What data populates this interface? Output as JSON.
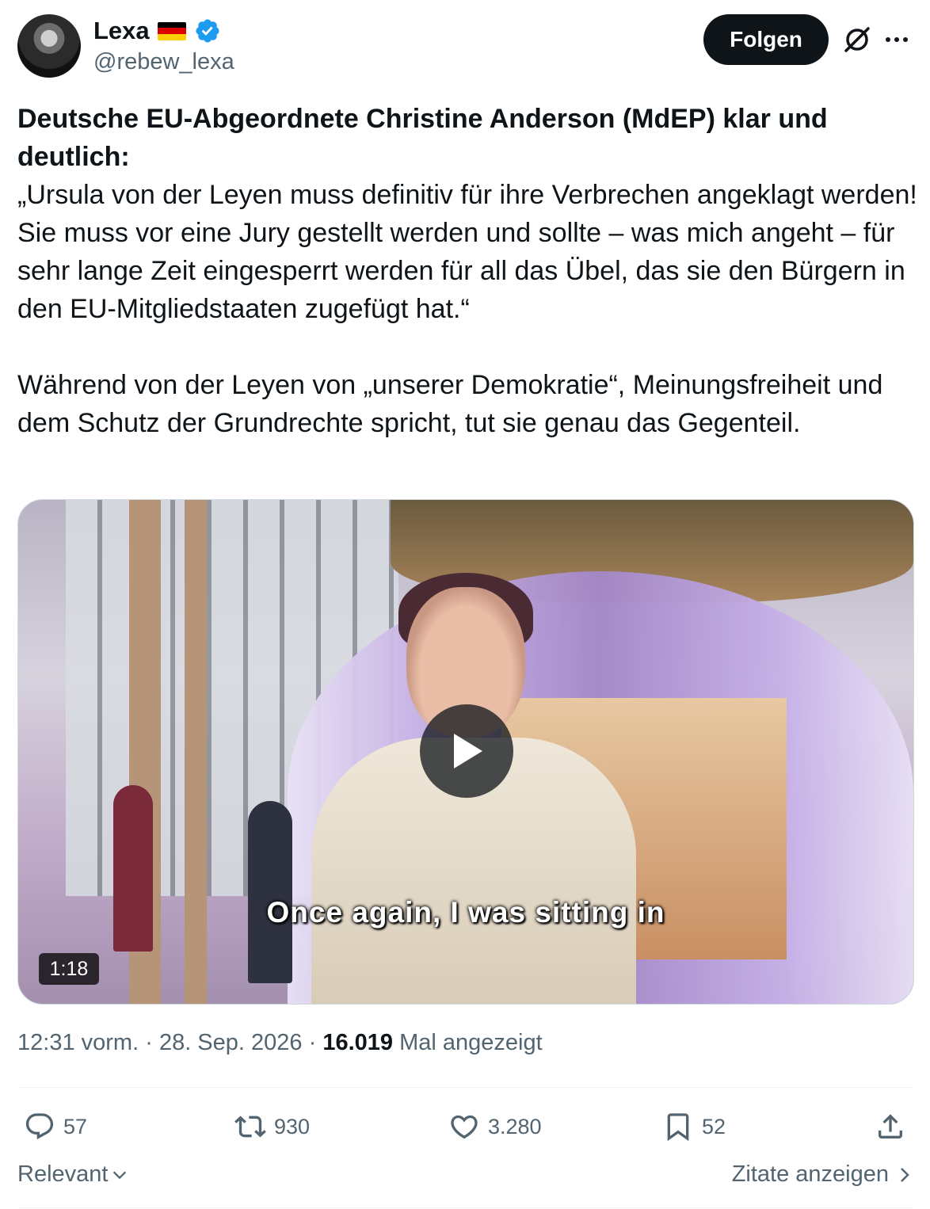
{
  "author": {
    "display_name": "Lexa",
    "handle": "@rebew_lexa",
    "flag_icon": "germany-flag-icon",
    "verified_icon": "verified-badge-icon",
    "verified_color": "#1d9bf0"
  },
  "header": {
    "follow_label": "Folgen",
    "grok_icon": "grok-icon",
    "more_icon": "more-icon"
  },
  "post": {
    "headline": "Deutsche EU-Abgeordnete Christine Anderson (MdEP) klar und deutlich:",
    "quote_line1": "„Ursula von der Leyen muss definitiv für ihre Verbrechen angeklagt werden!",
    "quote_line2": "Sie muss vor eine Jury gestellt werden und sollte – was mich angeht – für sehr lange Zeit eingesperrt werden für all das Übel, das sie den Bürgern in den EU-Mitgliedstaaten zugefügt hat.“",
    "paragraph2": "Während von der Leyen von „unserer Demokratie“, Meinungsfreiheit und dem Schutz der Grundrechte spricht, tut sie genau das Gegenteil."
  },
  "video": {
    "caption": "Once again, I was sitting in",
    "duration": "1:18",
    "play_icon": "play-icon"
  },
  "meta": {
    "time": "12:31 vorm.",
    "separator": "·",
    "date": "28. Sep. 2026",
    "views_count": "16.019",
    "views_label": "Mal angezeigt"
  },
  "actions": {
    "replies": "57",
    "reposts": "930",
    "likes": "3.280",
    "bookmarks": "52"
  },
  "footer": {
    "sort_label": "Relevant",
    "quotes_label": "Zitate anzeigen"
  },
  "colors": {
    "text": "#0f1419",
    "secondary": "#536471",
    "follow_bg": "#0f1419"
  }
}
